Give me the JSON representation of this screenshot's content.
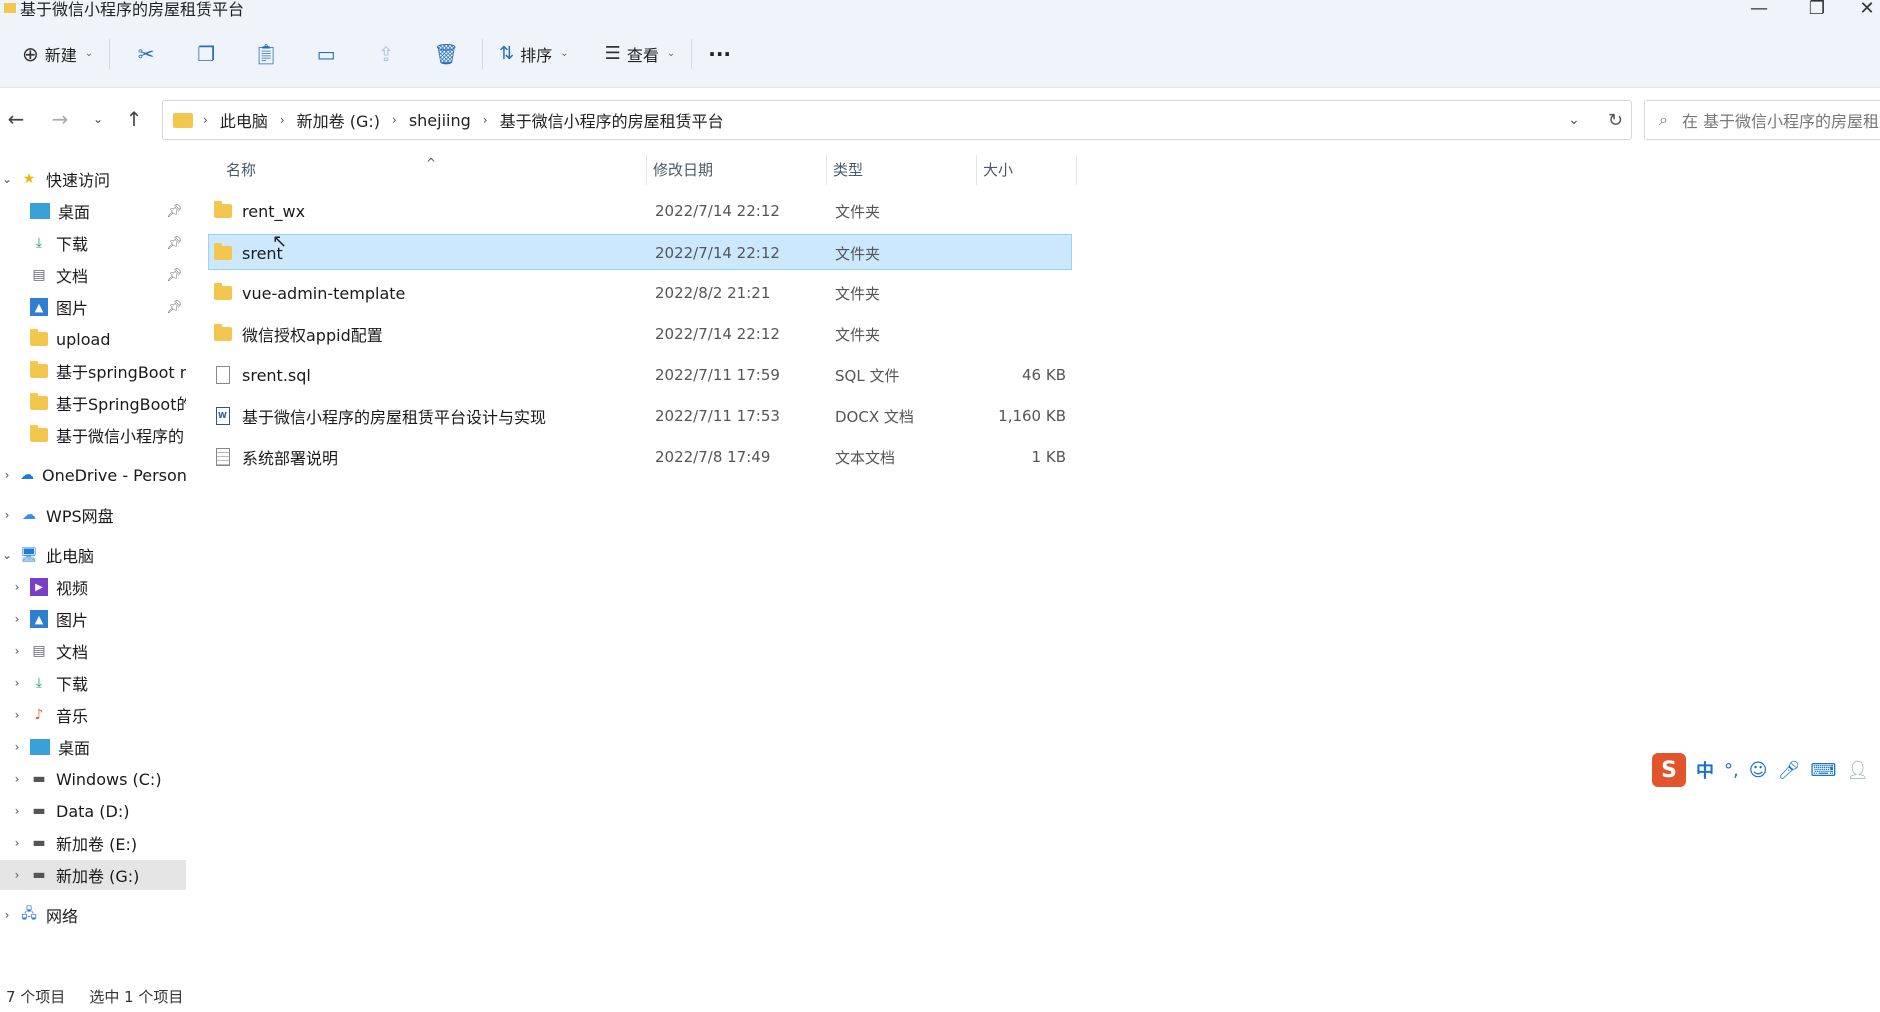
{
  "window": {
    "title": "基于微信小程序的房屋租赁平台",
    "minimize": "—",
    "restore": "❐",
    "close": "✕"
  },
  "toolbar": {
    "new_label": "新建",
    "sort_label": "排序",
    "view_label": "查看",
    "more_label": "···"
  },
  "address": {
    "crumbs": [
      "此电脑",
      "新加卷 (G:)",
      "shejiing",
      "基于微信小程序的房屋租赁平台"
    ],
    "search_placeholder": "在 基于微信小程序的房屋租赁平台 中搜索"
  },
  "sidebar": {
    "quick_access": "快速访问",
    "quick_items": [
      "桌面",
      "下载",
      "文档",
      "图片",
      "upload",
      "基于springBoot m",
      "基于SpringBoot的",
      "基于微信小程序的"
    ],
    "onedrive": "OneDrive - Persona",
    "wps": "WPS网盘",
    "this_pc": "此电脑",
    "pc_items": [
      "视频",
      "图片",
      "文档",
      "下载",
      "音乐",
      "桌面",
      "Windows (C:)",
      "Data (D:)",
      "新加卷 (E:)",
      "新加卷 (G:)"
    ],
    "network": "网络"
  },
  "columns": {
    "name": "名称",
    "date": "修改日期",
    "type": "类型",
    "size": "大小"
  },
  "files": [
    {
      "name": "rent_wx",
      "date": "2022/7/14 22:12",
      "type": "文件夹",
      "size": "",
      "icon": "folder"
    },
    {
      "name": "srent",
      "date": "2022/7/14 22:12",
      "type": "文件夹",
      "size": "",
      "icon": "folder"
    },
    {
      "name": "vue-admin-template",
      "date": "2022/8/2 21:21",
      "type": "文件夹",
      "size": "",
      "icon": "folder"
    },
    {
      "name": "微信授权appid配置",
      "date": "2022/7/14 22:12",
      "type": "文件夹",
      "size": "",
      "icon": "folder"
    },
    {
      "name": "srent.sql",
      "date": "2022/7/11 17:59",
      "type": "SQL 文件",
      "size": "46 KB",
      "icon": "file"
    },
    {
      "name": "基于微信小程序的房屋租赁平台设计与实现",
      "date": "2022/7/11 17:53",
      "type": "DOCX 文档",
      "size": "1,160 KB",
      "icon": "docx"
    },
    {
      "name": "系统部署说明",
      "date": "2022/7/8 17:49",
      "type": "文本文档",
      "size": "1 KB",
      "icon": "txt"
    }
  ],
  "status": {
    "count": "7 个项目",
    "selected": "选中 1 个项目"
  },
  "ime": {
    "logo": "S",
    "mode": "中",
    "punct": "°,"
  }
}
